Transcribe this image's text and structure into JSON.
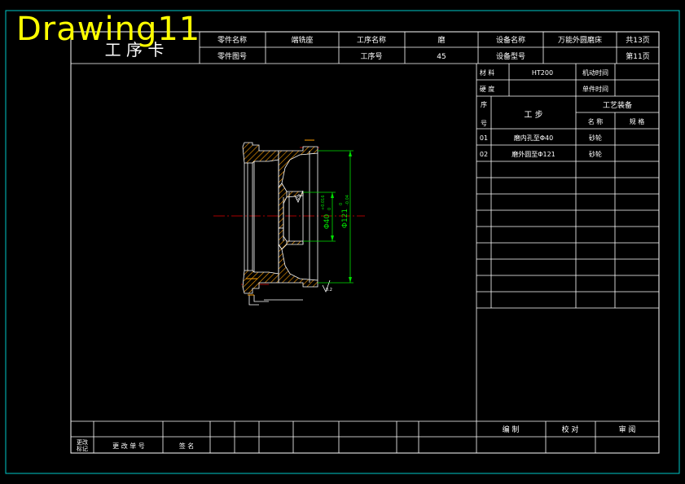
{
  "watermark": "Drawing11",
  "header": {
    "card_title": "工 序 卡",
    "part_name_label": "零件名称",
    "part_name": "端铣座",
    "part_no_label": "零件图号",
    "op_name_label": "工序名称",
    "op_name": "磨",
    "op_no_label": "工序号",
    "op_no": "45",
    "equip_name_label": "设备名称",
    "equip_name": "万能外圆磨床",
    "equip_model_label": "设备型号",
    "total_pages": "共13页",
    "page_no": "第11页"
  },
  "process": {
    "material_label": "材 料",
    "material": "HT200",
    "machine_time_label": "机动时间",
    "hardness_label": "硬 度",
    "unit_time_label": "单件时间",
    "seq_label_top": "序",
    "seq_label_bottom": "号",
    "step_label": "工 步",
    "equipment_label": "工艺装备",
    "name_label": "名 称",
    "spec_label": "规 格",
    "steps": [
      {
        "no": "01",
        "desc": "磨内孔至Φ40",
        "tool": "砂轮"
      },
      {
        "no": "02",
        "desc": "磨外圆至Φ121",
        "tool": "砂轮"
      }
    ]
  },
  "drawing": {
    "dim_inner": "Φ40",
    "dim_inner_tol": "+0.016",
    "dim_inner_tol_low": "0",
    "dim_outer": "Φ121",
    "dim_outer_tol": "0",
    "dim_outer_tol_low": "-0.04",
    "roughness": "0.2"
  },
  "footer": {
    "change_mark_label_1": "更改",
    "change_mark_label_2": "标记",
    "change_doc_label": "更 改 单 号",
    "sign_label": "签 名",
    "compile_label": "编 制",
    "check_label": "校 对",
    "review_label": "审 阅"
  },
  "colors": {
    "frame": "#ffffff",
    "border": "#00c8c8",
    "section_fill": "#ffa000",
    "dimension": "#00e000",
    "centerline": "#e00000",
    "watermark": "#ffff00"
  }
}
